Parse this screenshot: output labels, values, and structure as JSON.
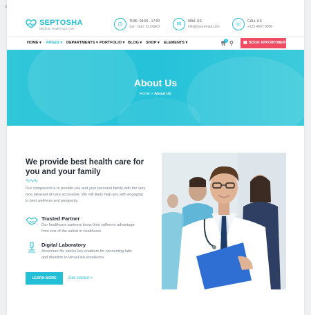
{
  "brand": {
    "name": "SEPTOSHA",
    "tagline": "Medical, Health and Care"
  },
  "topbar": {
    "time": {
      "label": "TIME: 09:00 - 17:00",
      "value": "Sat - Sun: CLOSED",
      "icon": "clock-icon"
    },
    "mail": {
      "label": "MAIL US",
      "value": "info@youremail.com",
      "icon": "mail-icon"
    },
    "call": {
      "label": "CALL US",
      "value": "+123 4567 8900",
      "icon": "phone-icon"
    }
  },
  "nav": {
    "items": [
      "HOME",
      "PAGES",
      "DEPARTMENTS",
      "PORTFOLIO",
      "BLOG",
      "SHOP",
      "ELEMENTS"
    ],
    "cart_count": "0",
    "book_label": "BOOK APPOINTMENT"
  },
  "hero": {
    "title": "About Us",
    "crumb_home": "Home",
    "crumb_sep": ">",
    "crumb_current": "About Us"
  },
  "about": {
    "title": "We provide best health care for you and your family",
    "paragraph": "Our component is to provide you and your personal family with the very nice pleasant of care accessible. We will likely help you with engaging in best wellness and prosperity.",
    "features": [
      {
        "title": "Trusted Partner",
        "text": "Our healthcare partners know their sufferers advantage from one of the safest in healthcare."
      },
      {
        "title": "Digital Laboratory",
        "text": "Accenture file stocks key enablers for connecting labs and direction to virtual lab excellence."
      }
    ],
    "learn_more": "LEARN MORE",
    "get_started": "Get started",
    "get_started_arrow": ">"
  },
  "colors": {
    "accent": "#22bfd6",
    "book": "#ef4b62",
    "heading": "#1f2731"
  }
}
